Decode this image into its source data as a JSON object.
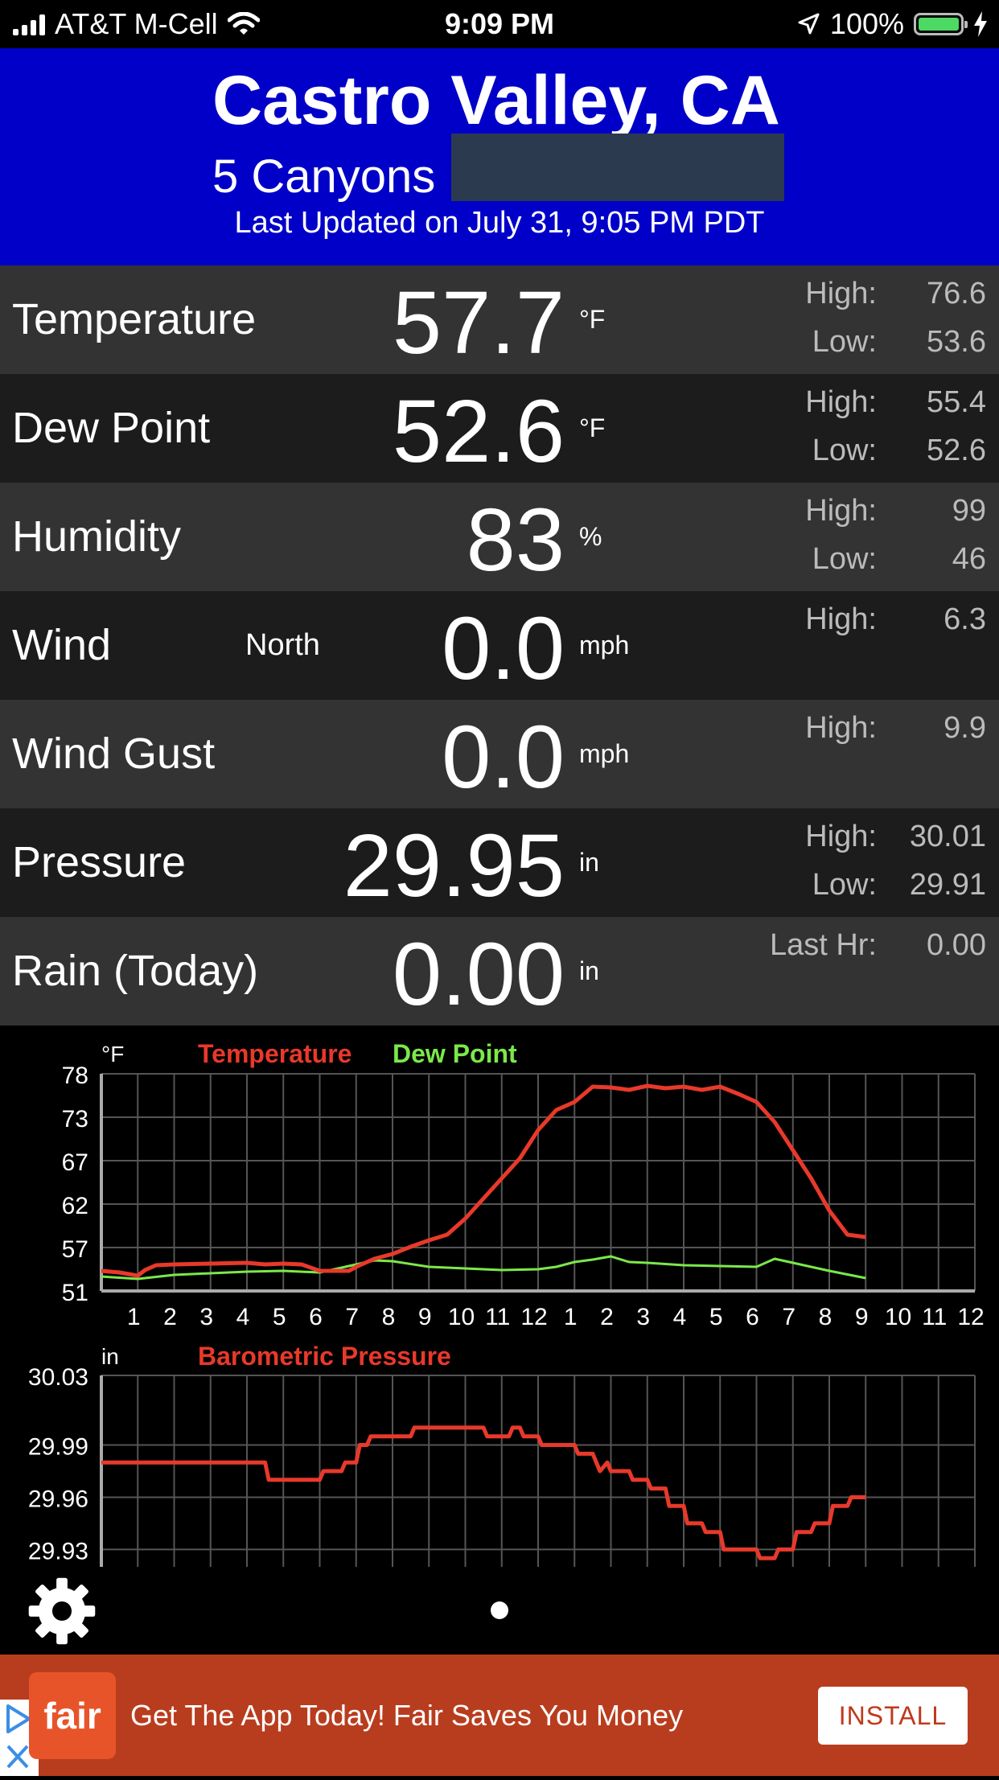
{
  "status_bar": {
    "carrier": "AT&T M-Cell",
    "time": "9:09 PM",
    "battery": "100%",
    "battery_level": 1.0
  },
  "header": {
    "city": "Castro Valley, CA",
    "station": "5 Canyons",
    "updated": "Last Updated on July 31, 9:05 PM PDT"
  },
  "rows": [
    {
      "label": "Temperature",
      "value": "57.7",
      "unit": "°F",
      "k1": "High:",
      "v1": "76.6",
      "k2": "Low:",
      "v2": "53.6"
    },
    {
      "label": "Dew Point",
      "value": "52.6",
      "unit": "°F",
      "k1": "High:",
      "v1": "55.4",
      "k2": "Low:",
      "v2": "52.6"
    },
    {
      "label": "Humidity",
      "value": "83",
      "unit": "%",
      "k1": "High:",
      "v1": "99",
      "k2": "Low:",
      "v2": "46"
    },
    {
      "label": "Wind",
      "direction": "North",
      "value": "0.0",
      "unit": "mph",
      "k1": "High:",
      "v1": "6.3"
    },
    {
      "label": "Wind Gust",
      "value": "0.0",
      "unit": "mph",
      "k1": "High:",
      "v1": "9.9"
    },
    {
      "label": "Pressure",
      "value": "29.95",
      "unit": "in",
      "k1": "High:",
      "v1": "30.01",
      "k2": "Low:",
      "v2": "29.91"
    },
    {
      "label": "Rain (Today)",
      "value": "0.00",
      "unit": "in",
      "k1": "Last Hr:",
      "v1": "0.00"
    }
  ],
  "colors": {
    "header_bg": "#0000c8",
    "temp_line": "#e8392a",
    "dew_line": "#7be84a",
    "ad_bg": "#b83d1e"
  },
  "chart_data": [
    {
      "type": "line",
      "unit_label": "°F",
      "ylim": [
        51,
        78
      ],
      "yticks": [
        "78",
        "73",
        "67",
        "62",
        "57",
        "51"
      ],
      "xticks": [
        "1",
        "2",
        "3",
        "4",
        "5",
        "6",
        "7",
        "8",
        "9",
        "10",
        "11",
        "12",
        "1",
        "2",
        "3",
        "4",
        "5",
        "6",
        "7",
        "8",
        "9",
        "10",
        "11",
        "12"
      ],
      "xlim": [
        0,
        24
      ],
      "grid": true,
      "series": [
        {
          "name": "Temperature",
          "color": "#e8392a",
          "x": [
            0,
            0.5,
            1,
            1.2,
            1.5,
            2,
            3,
            4,
            4.5,
            5,
            5.5,
            6,
            6.5,
            6.8,
            7,
            7.5,
            8,
            8.5,
            9,
            9.5,
            10,
            10.5,
            11,
            11.5,
            12,
            12.5,
            13,
            13.5,
            14,
            14.5,
            15,
            15.5,
            16,
            16.5,
            17,
            17.5,
            18,
            18.5,
            19,
            19.5,
            20,
            20.5,
            21
          ],
          "y": [
            53.5,
            53.3,
            52.9,
            53.6,
            54.2,
            54.3,
            54.4,
            54.5,
            54.3,
            54.4,
            54.3,
            53.5,
            53.5,
            53.5,
            54,
            55,
            55.6,
            56.5,
            57.3,
            58,
            60,
            62.5,
            65,
            67.5,
            71,
            73.5,
            74.5,
            76.4,
            76.3,
            76,
            76.5,
            76.2,
            76.4,
            76,
            76.4,
            75.5,
            74.5,
            72,
            68.5,
            65,
            61,
            58,
            57.7
          ]
        },
        {
          "name": "Dew Point",
          "color": "#7be84a",
          "x": [
            0,
            1,
            2,
            3,
            4,
            5,
            6,
            7,
            7.5,
            8,
            9,
            10,
            11,
            12,
            12.5,
            13,
            13.5,
            14,
            14.5,
            15,
            16,
            17,
            18,
            18.5,
            19,
            20,
            21
          ],
          "y": [
            52.8,
            52.5,
            53,
            53.2,
            53.4,
            53.5,
            53.3,
            54.3,
            54.8,
            54.7,
            54,
            53.8,
            53.6,
            53.7,
            54,
            54.6,
            54.9,
            55.3,
            54.6,
            54.5,
            54.2,
            54.1,
            54,
            55,
            54.5,
            53.5,
            52.6
          ]
        }
      ]
    },
    {
      "type": "line",
      "unit_label": "in",
      "ylim": [
        29.92,
        30.03
      ],
      "yticks": [
        "30.03",
        "29.99",
        "29.96",
        "29.93"
      ],
      "grid": true,
      "series": [
        {
          "name": "Barometric Pressure",
          "color": "#e8392a",
          "x": [
            0,
            4.5,
            4.6,
            6,
            6.1,
            6.6,
            6.7,
            7,
            7.1,
            7.3,
            7.4,
            8.5,
            8.6,
            10.5,
            10.6,
            11.2,
            11.3,
            11.5,
            11.6,
            12,
            12.1,
            13,
            13.1,
            13.5,
            13.7,
            13.9,
            14.0,
            14.5,
            14.6,
            15,
            15.1,
            15.5,
            15.6,
            16,
            16.1,
            16.5,
            16.6,
            17,
            17.1,
            18,
            18.1,
            18.5,
            18.6,
            19,
            19.1,
            19.5,
            19.6,
            20,
            20.1,
            20.5,
            20.6,
            21
          ],
          "y": [
            29.98,
            29.98,
            29.97,
            29.97,
            29.975,
            29.975,
            29.98,
            29.98,
            29.99,
            29.99,
            29.995,
            29.995,
            30.0,
            30.0,
            29.995,
            29.995,
            30.0,
            30.0,
            29.995,
            29.995,
            29.99,
            29.99,
            29.985,
            29.985,
            29.975,
            29.98,
            29.975,
            29.975,
            29.97,
            29.97,
            29.965,
            29.965,
            29.955,
            29.955,
            29.945,
            29.945,
            29.94,
            29.94,
            29.93,
            29.93,
            29.925,
            29.925,
            29.93,
            29.93,
            29.94,
            29.94,
            29.945,
            29.945,
            29.955,
            29.955,
            29.96,
            29.96
          ]
        }
      ]
    }
  ],
  "ad": {
    "brand": "fair",
    "text": "Get The App Today! Fair Saves You Money",
    "button": "INSTALL"
  }
}
